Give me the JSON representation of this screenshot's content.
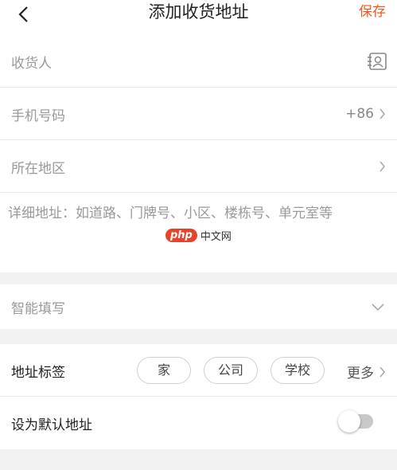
{
  "header": {
    "title": "添加收货地址",
    "save_label": "保存",
    "back_icon": "chevron-left-icon"
  },
  "form": {
    "recipient_placeholder": "收货人",
    "contact_book_icon": "contact-book-icon",
    "phone_placeholder": "手机号码",
    "country_code": "+86",
    "region_placeholder": "所在地区",
    "detail_placeholder": "详细地址：如道路、门牌号、小区、楼栋号、单元室等"
  },
  "smart_fill": {
    "label": "智能填写",
    "icon": "chevron-down-icon"
  },
  "address_tags": {
    "label": "地址标签",
    "tags": [
      "家",
      "公司",
      "学校"
    ],
    "more_label": "更多"
  },
  "default_address": {
    "label": "设为默认地址",
    "enabled": false
  },
  "watermark": {
    "logo_text": "php",
    "site_text": "中文网"
  },
  "colors": {
    "accent": "#ee5a24",
    "background": "#f2f2f2",
    "card": "#ffffff",
    "placeholder": "#999999"
  }
}
